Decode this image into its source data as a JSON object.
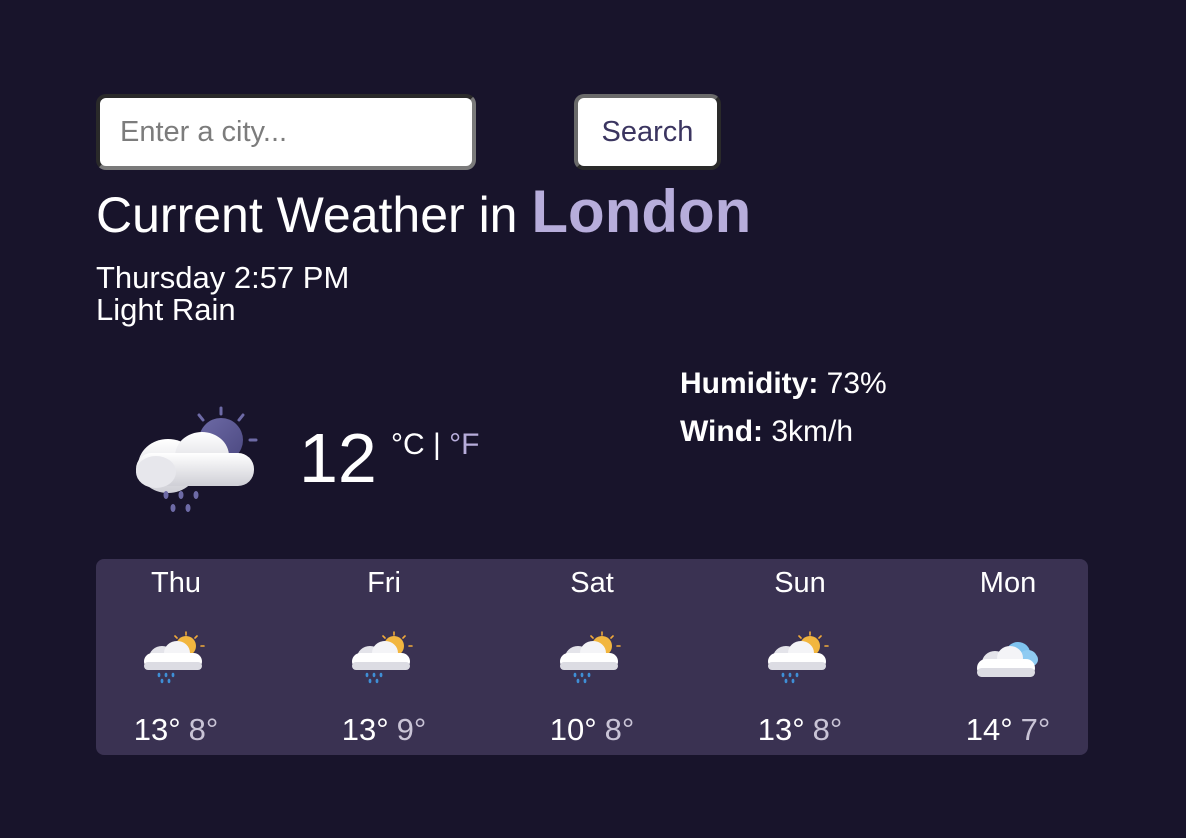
{
  "search": {
    "placeholder": "Enter a city...",
    "value": "",
    "button_label": "Search"
  },
  "current": {
    "title_prefix": "Current Weather in ",
    "city": "London",
    "datetime": "Thursday 2:57 PM",
    "condition": "Light Rain",
    "icon": "light-rain-night-icon",
    "temperature": "12",
    "unit_c": "°C",
    "unit_separator": "|",
    "unit_f": "°F",
    "humidity_label": "Humidity:",
    "humidity_value": "73%",
    "wind_label": "Wind:",
    "wind_value": "3km/h"
  },
  "forecast": [
    {
      "day": "Thu",
      "icon": "light-rain-day-icon",
      "max": "13°",
      "min": "8°"
    },
    {
      "day": "Fri",
      "icon": "light-rain-day-icon",
      "max": "13°",
      "min": "9°"
    },
    {
      "day": "Sat",
      "icon": "light-rain-day-icon",
      "max": "10°",
      "min": "8°"
    },
    {
      "day": "Sun",
      "icon": "light-rain-day-icon",
      "max": "13°",
      "min": "8°"
    },
    {
      "day": "Mon",
      "icon": "overcast-clouds-icon",
      "max": "14°",
      "min": "7°"
    }
  ],
  "colors": {
    "background": "#18142b",
    "forecast_panel": "#3a3252",
    "accent": "#b7addb"
  }
}
